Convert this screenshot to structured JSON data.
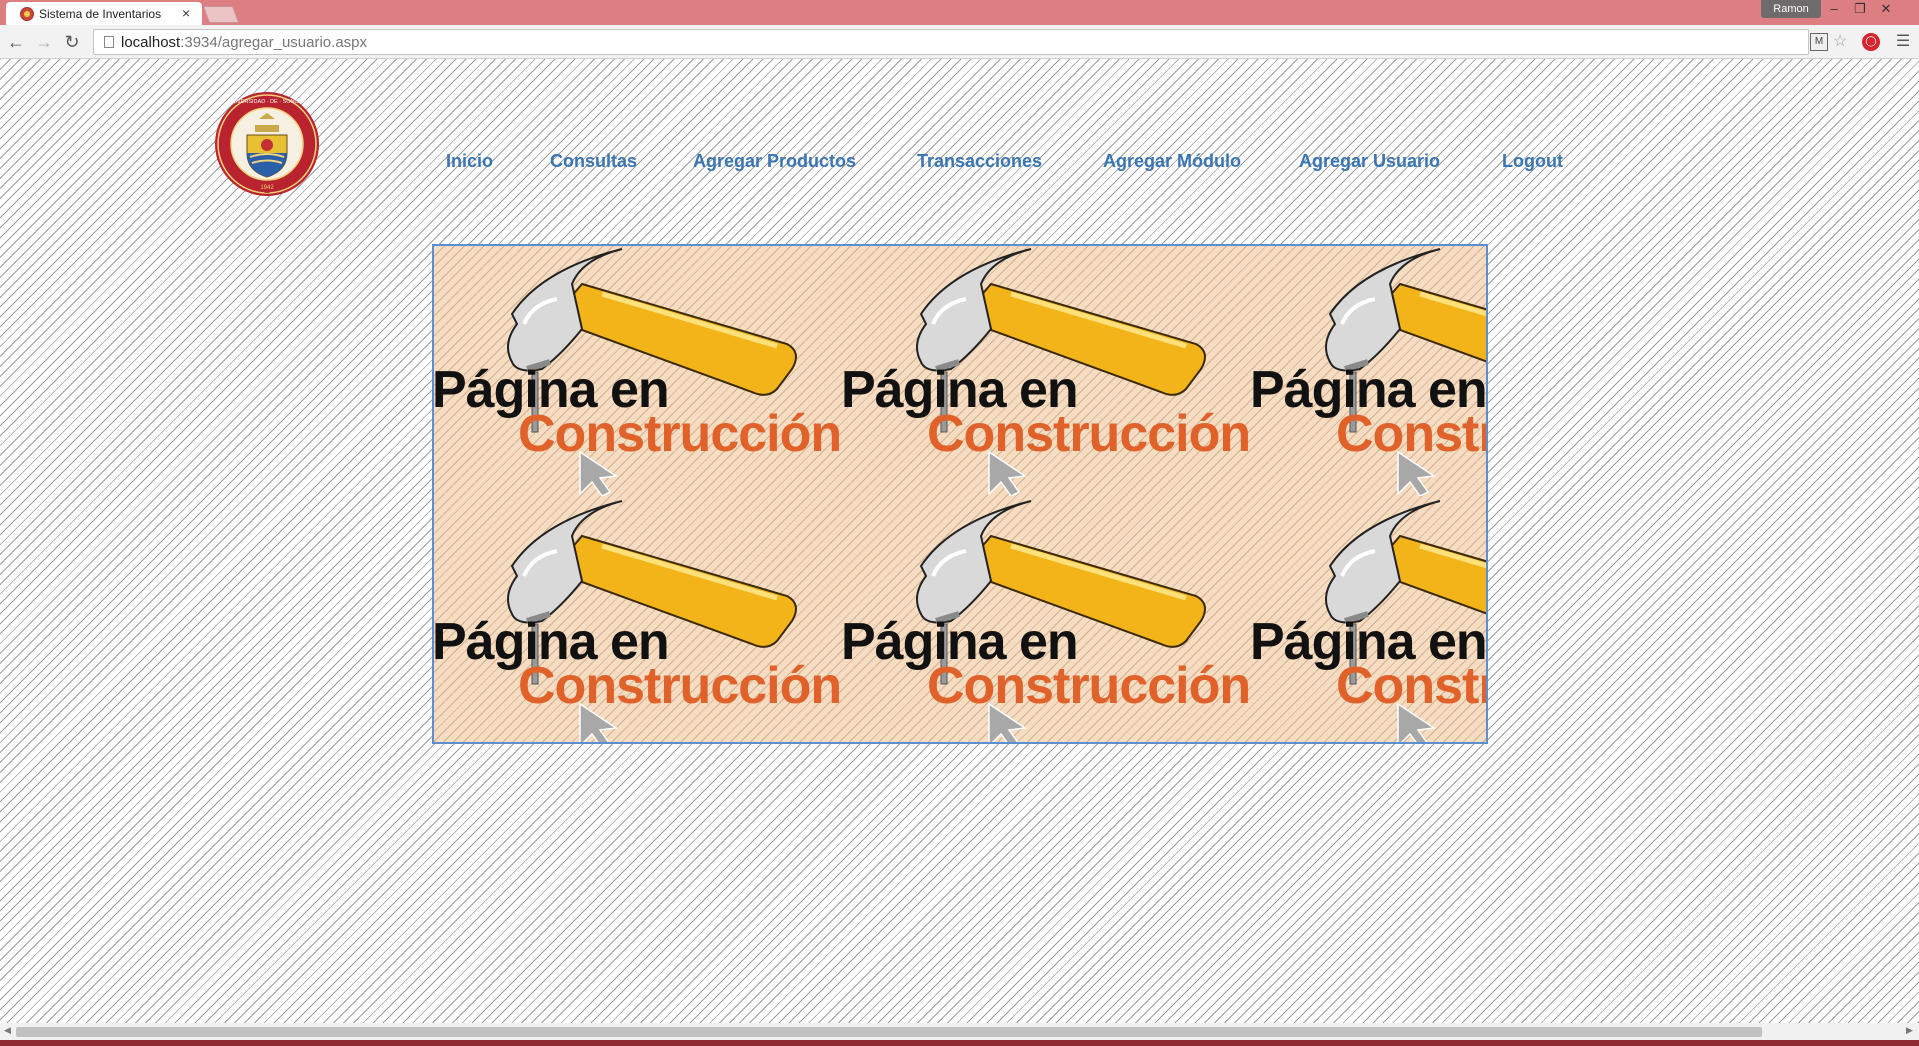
{
  "browser": {
    "tab_title": "Sistema de Inventarios",
    "tab_close": "×",
    "profile_name": "Ramon",
    "url_host": "localhost",
    "url_rest": ":3934/agregar_usuario.aspx",
    "icons": {
      "back": "arrow-left-icon",
      "forward": "arrow-right-icon",
      "reload": "reload-icon",
      "bookmark": "star-icon",
      "menu": "hamburger-menu-icon"
    },
    "window_controls": {
      "minimize": "–",
      "maximize": "❐",
      "close": "✕"
    }
  },
  "page": {
    "logo_alt": "Universidad de Sonora seal",
    "logo_text_top": "UNIVERSIDAD · DE · SONORA",
    "logo_year": "1942",
    "nav": [
      "Inicio",
      "Consultas",
      "Agregar Productos",
      "Transacciones",
      "Agregar Módulo",
      "Agregar Usuario",
      "Logout"
    ],
    "construction": {
      "line1": "Página en",
      "line2": "Construcción"
    }
  },
  "colors": {
    "titlebar": "#dc7e82",
    "nav_link": "#3a75b4",
    "construction_bg": "#f6dcc1",
    "construction_orange": "#e0622a",
    "hammer_handle": "#f2b418"
  }
}
